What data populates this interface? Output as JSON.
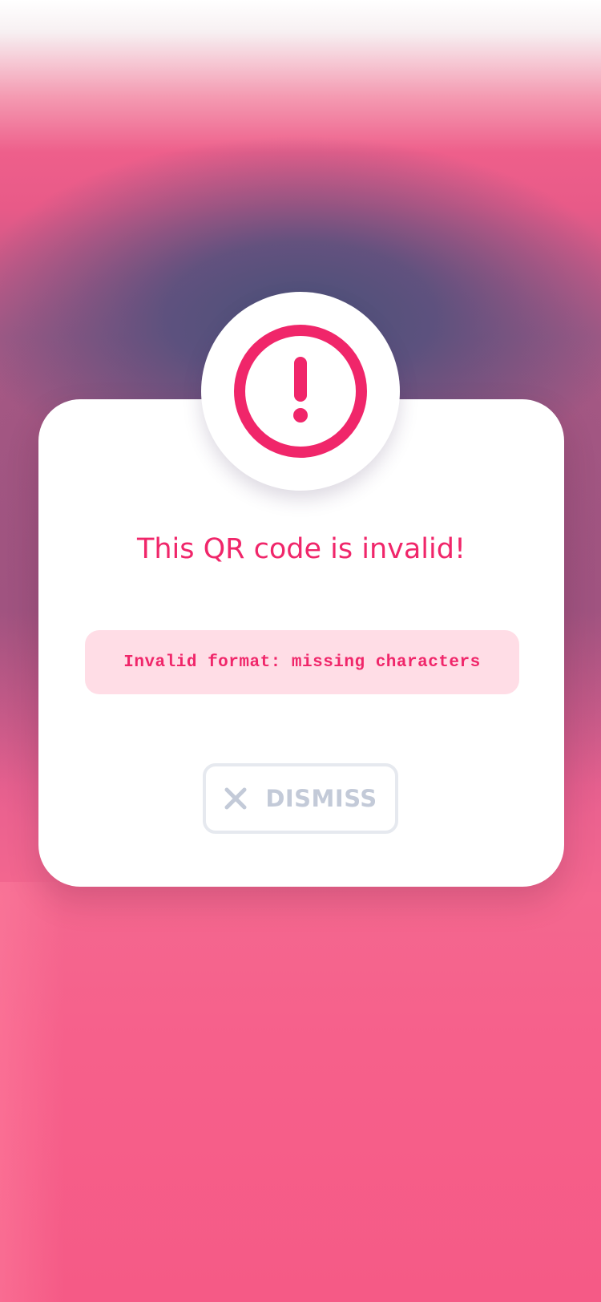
{
  "dialog": {
    "title": "This QR code is invalid!",
    "error_message": "Invalid format: missing characters",
    "dismiss_label": "DISMISS",
    "icon": "alert-circle-icon",
    "dismiss_icon": "close-icon"
  },
  "colors": {
    "accent": "#f0266a",
    "error_box_bg": "#ffdde6",
    "dismiss_text": "#c3cad8",
    "dismiss_border": "#e6e9ef"
  }
}
